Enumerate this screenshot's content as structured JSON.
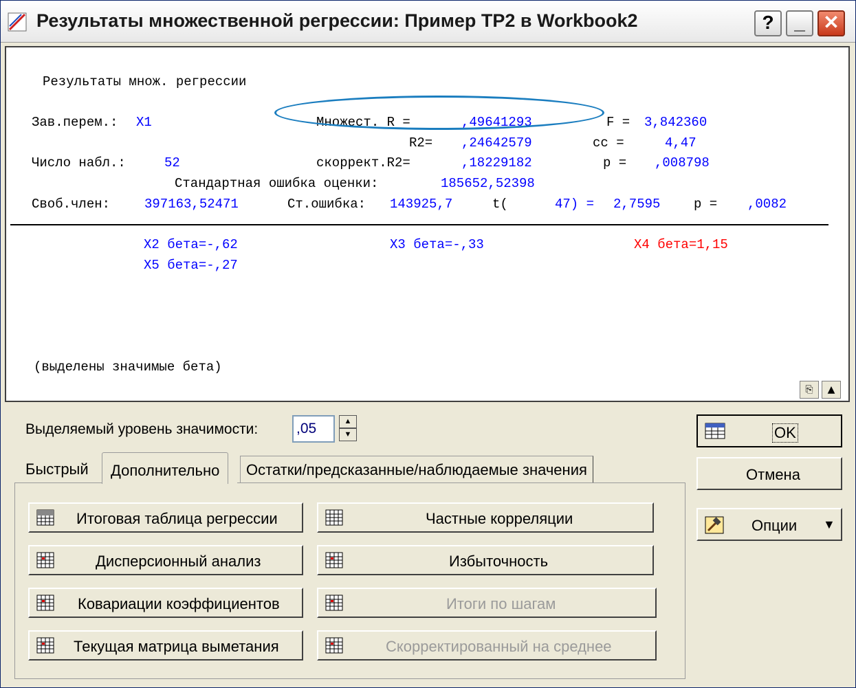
{
  "window": {
    "title": "Результаты множественной регрессии: Пример TP2 в Workbook2",
    "help": "?",
    "minimize": "_",
    "close": "✕"
  },
  "output": {
    "header": "Результаты множ. регрессии",
    "dep_var_label": "Зав.перем.:",
    "dep_var": "X1",
    "mult_r_label": "Множест. R =",
    "mult_r": ",49641293",
    "f_label": "F =",
    "f_value": "3,842360",
    "r2_label": "R2=",
    "r2": ",24642579",
    "df_label": "cc =",
    "df_value": "4,47",
    "n_label": "Число набл.:",
    "n": "52",
    "adj_r2_label": "скоррект.R2=",
    "adj_r2": ",18229182",
    "p_label": "p =",
    "p_value": ",008798",
    "se_label": "Стандартная ошибка оценки:",
    "se_value": "185652,52398",
    "intercept_label": "Своб.член:",
    "intercept_value": "397163,52471",
    "intercept_se_label": "Ст.ошибка:",
    "intercept_se": "143925,7",
    "t_label": "t(",
    "t_df": "47) =",
    "t_value": "2,7595",
    "intercept_p_label": "p =",
    "intercept_p": ",0082",
    "beta_x2": "X2 бета=-,62",
    "beta_x3": "X3 бета=-,33",
    "beta_x4": "X4 бета=1,15",
    "beta_x5": "X5 бета=-,27",
    "footnote": "(выделены значимые бета)"
  },
  "controls": {
    "sig_level_label": "Выделяемый уровень значимости:",
    "sig_level_value": ",05"
  },
  "tabs": [
    "Быстрый",
    "Дополнительно",
    "Остатки/предсказанные/наблюдаемые значения"
  ],
  "buttons": {
    "summary_table": "Итоговая таблица регрессии",
    "partial_corr": "Частные корреляции",
    "anova": "Дисперсионный анализ",
    "redundancy": "Избыточность",
    "coef_cov": "Ковариации коэффициентов",
    "step_summary": "Итоги по шагам",
    "sweep_matrix": "Текущая матрица выметания",
    "centered": "Скорректированный на среднее"
  },
  "side_buttons": {
    "ok": "OK",
    "cancel": "Отмена",
    "options": "Опции"
  },
  "colors": {
    "significant": "#ff0000",
    "value_blue": "#0000ff",
    "annotation_ellipse": "#1a7dbf"
  }
}
